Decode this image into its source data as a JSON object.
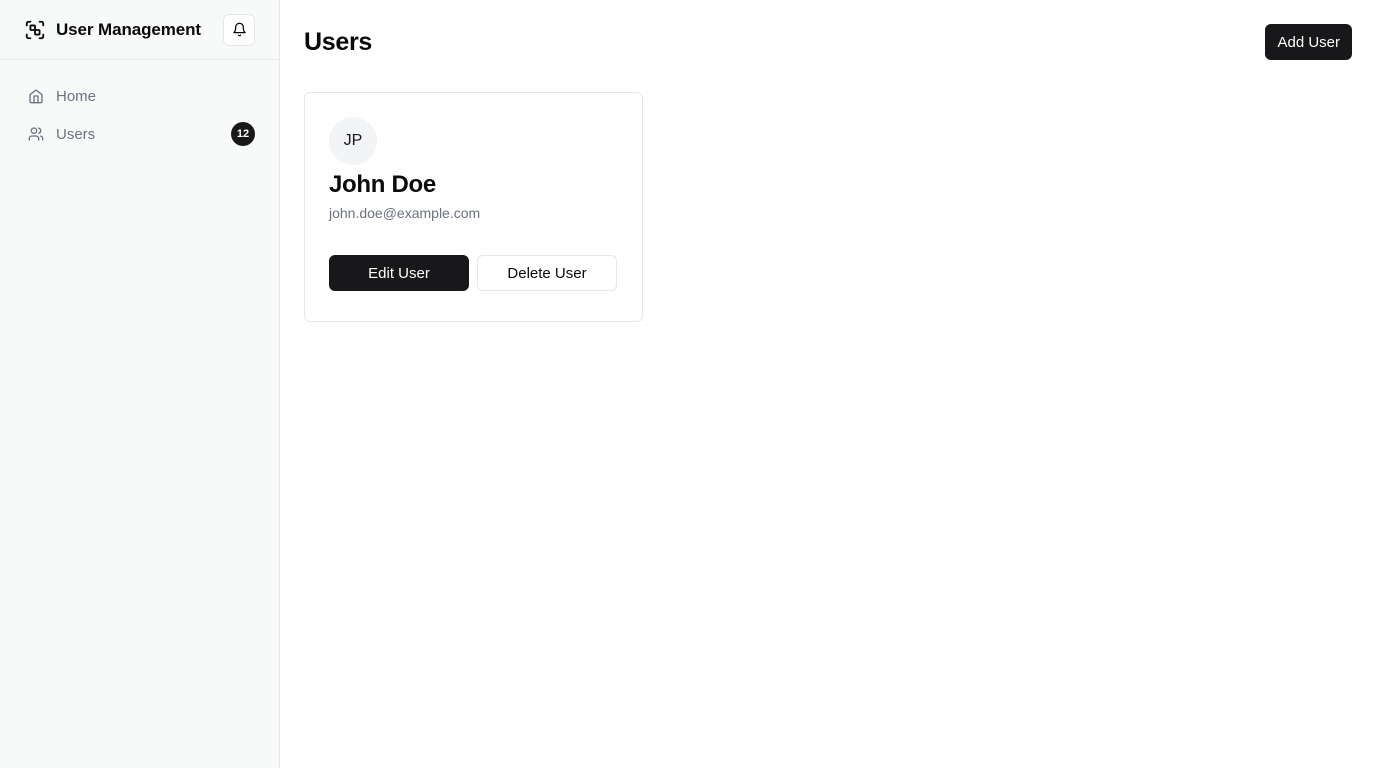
{
  "sidebar": {
    "brand": {
      "title": "User Management",
      "icon": "scan-face-icon"
    },
    "notifications": {
      "icon": "bell-icon"
    },
    "nav": [
      {
        "label": "Home",
        "icon": "home-icon"
      },
      {
        "label": "Users",
        "icon": "users-icon",
        "badge": "12"
      }
    ]
  },
  "main": {
    "title": "Users",
    "add_button_label": "Add User"
  },
  "user_card": {
    "initials": "JP",
    "name": "John Doe",
    "email": "john.doe@example.com",
    "edit_label": "Edit User",
    "delete_label": "Delete User"
  },
  "colors": {
    "sidebar_bg": "#f8faf9",
    "primary": "#18181b",
    "muted_text": "#6b7280",
    "border": "#e5e7eb"
  }
}
